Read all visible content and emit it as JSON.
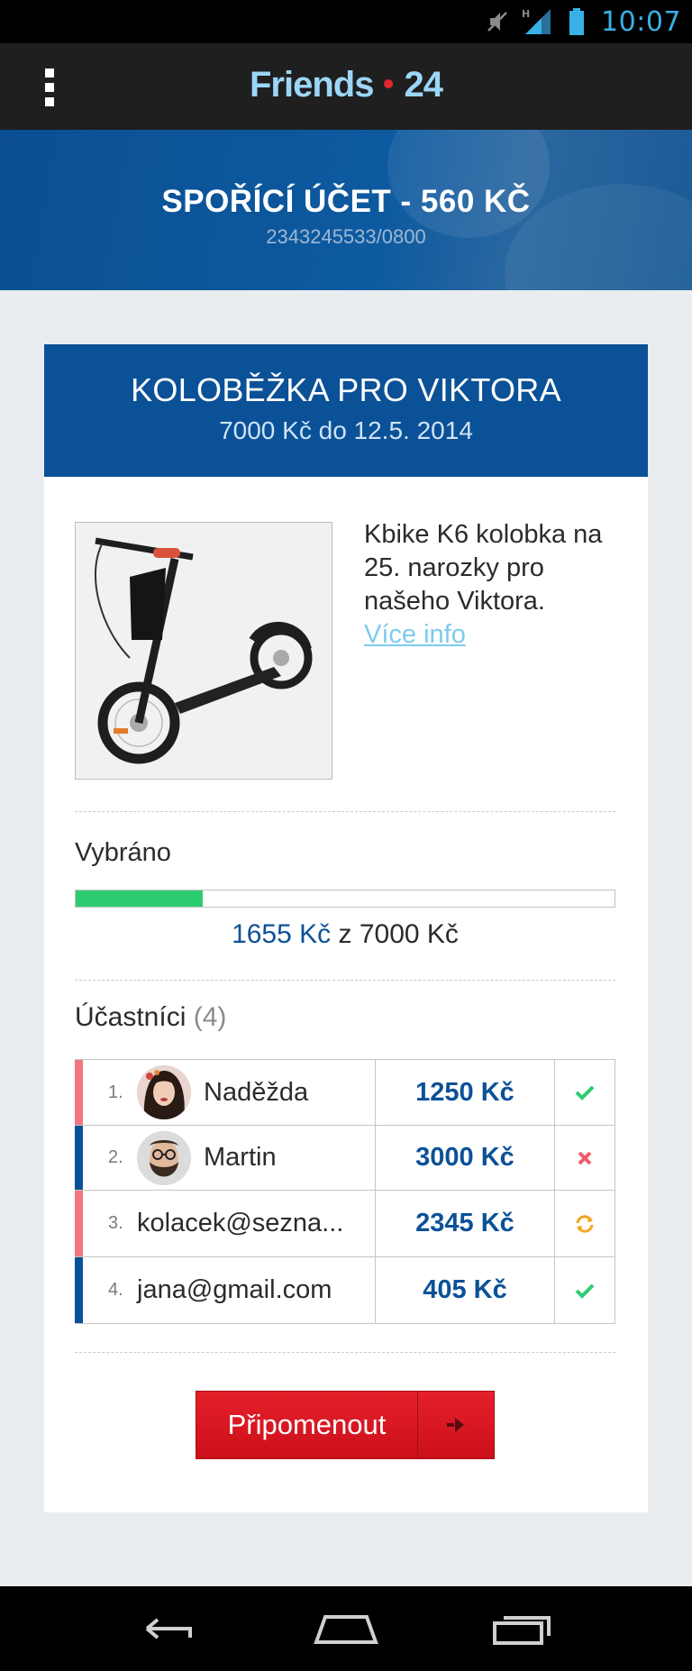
{
  "status_bar": {
    "time": "10:07",
    "network_label": "H",
    "icons": [
      "mute-icon",
      "signal-icon",
      "battery-icon"
    ]
  },
  "app_bar": {
    "title_part1": "Friends",
    "title_part2": "24",
    "menu_icon": "overflow-menu-icon"
  },
  "account": {
    "title": "SPOŘÍCÍ ÚČET - 560 KČ",
    "number": "2343245533/0800"
  },
  "collection": {
    "title": "KOLOBĚŽKA PRO VIKTORA",
    "subtitle": "7000 Kč do 12.5. 2014",
    "description": "Kbike K6 kolobka na 25. narozky pro našeho Viktora.",
    "more_info_label": "Více info",
    "collected_label": "Vybráno",
    "raised": "1655 Kč",
    "progress_separator": " z ",
    "goal": "7000 Kč",
    "progress_fraction": 0.2364,
    "participants_label": "Účastníci",
    "participants_count": "(4)",
    "participants": [
      {
        "num": "1.",
        "name": "Naděžda",
        "amount": "1250 Kč",
        "status": "paid",
        "accent": "pink",
        "has_avatar": true
      },
      {
        "num": "2.",
        "name": "Martin",
        "amount": "3000 Kč",
        "status": "declined",
        "accent": "blue",
        "has_avatar": true
      },
      {
        "num": "3.",
        "name": "kolacek@sezna...",
        "amount": "2345 Kč",
        "status": "pending",
        "accent": "pink",
        "has_avatar": false
      },
      {
        "num": "4.",
        "name": "jana@gmail.com",
        "amount": "405 Kč",
        "status": "paid",
        "accent": "blue",
        "has_avatar": false
      }
    ],
    "remind_button": "Připomenout"
  },
  "colors": {
    "primary_blue": "#0b5197",
    "accent_red": "#e3262f",
    "progress_green": "#2ecc71",
    "link_blue": "#7ecbef",
    "pink_accent": "#f0767f"
  }
}
